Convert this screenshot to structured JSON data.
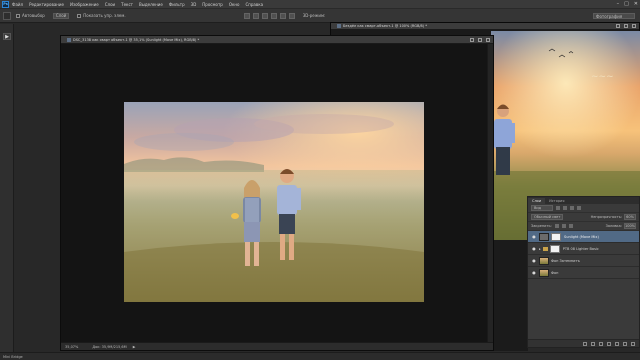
{
  "app": {
    "logo": "Ps"
  },
  "menu": [
    "Файл",
    "Редактирование",
    "Изображение",
    "Слои",
    "Текст",
    "Выделение",
    "Фильтр",
    "3D",
    "Просмотр",
    "Окно",
    "Справка"
  ],
  "window_controls": [
    "–",
    "□",
    "✕"
  ],
  "options": {
    "autoselect_label": "Автовыбор",
    "autoselect_value": "Слой",
    "show_controls_label": "Показать упр. элем.",
    "mode_3d_label": "3D-режим:"
  },
  "workspace": {
    "value": "Фотография"
  },
  "tools": {
    "expand_icon": "▶"
  },
  "document": {
    "title": "DSC_3138 как сварт объект-1 @ 35,1% (Sunlight (Move Mix), RGB/8) *",
    "zoom": "35,07%",
    "doc_size": "Док: 35,9M/215,6M",
    "arrow": "▶"
  },
  "document2": {
    "title": "Бездёл как смарт-объект-1 @ 100% (RGB/8) *"
  },
  "layers_panel": {
    "tabs": [
      "Слои",
      "История"
    ],
    "kind_label": "Вид",
    "blend_mode": "Обычный свет",
    "opacity_label": "Непрозрачность:",
    "opacity_value": "60%",
    "lock_label": "Закрепить:",
    "fill_label": "Заливка:",
    "fill_value": "100%",
    "layers": [
      {
        "name": "Sunlight (Move Mix)",
        "selected": true,
        "type": "mask"
      },
      {
        "name": "PTB 08 Lighter Basic",
        "selected": false,
        "type": "group"
      },
      {
        "name": "Фон Затемнитъ",
        "selected": false,
        "type": "photo"
      },
      {
        "name": "Фон",
        "selected": false,
        "type": "photo"
      }
    ]
  },
  "status_bar": {
    "text": "Mini Bridge"
  },
  "colors": {
    "accent_selected": "#516a86",
    "app_bg": "#282828",
    "panel_bg": "#3a3a3a"
  }
}
